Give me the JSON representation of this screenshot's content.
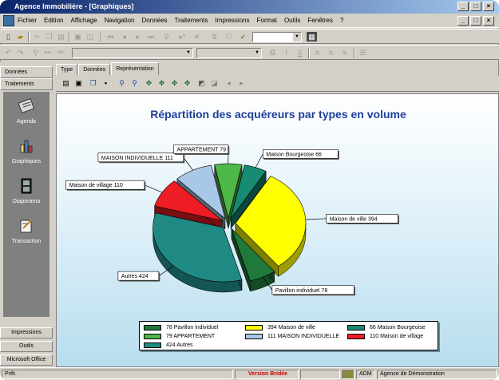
{
  "window": {
    "title": "Agence Immobilière - [Graphiques]",
    "buttons": [
      "_",
      "□",
      "×"
    ]
  },
  "menubar": {
    "items": [
      "Fichier",
      "Edition",
      "Affichage",
      "Navigation",
      "Données",
      "Traitements",
      "Impressions",
      "Format",
      "Outils",
      "Fenêtres",
      "?"
    ],
    "mdi_buttons": [
      "_",
      "□",
      "×"
    ]
  },
  "toolbar1": {
    "icons": [
      "new-icon",
      "open-icon",
      "cut-icon",
      "copy-icon",
      "paste-icon",
      "print-icon",
      "print-preview-icon",
      "first-record-icon",
      "previous-record-icon",
      "next-record-icon",
      "last-record-icon",
      "find-icon",
      "new-record-icon",
      "delete-record-icon",
      "sort-icon",
      "filter-icon",
      "check-icon",
      "color-icon"
    ]
  },
  "toolbar2": {
    "icons": [
      "undo-icon",
      "redo-icon",
      "find-icon",
      "replace-icon",
      "spelling-icon",
      "bold-icon",
      "italic-icon",
      "underline-icon",
      "align-left-icon",
      "align-center-icon",
      "align-right-icon",
      "bullets-icon"
    ],
    "bold_glyph": "G",
    "italic_glyph": "I",
    "underline_glyph": "S"
  },
  "leftpanel": {
    "top_sections": [
      "Données",
      "Traitements"
    ],
    "items": [
      {
        "label": "Agenda",
        "icon": "agenda-icon"
      },
      {
        "label": "Graphiques",
        "icon": "graphics-icon"
      },
      {
        "label": "Diaporama",
        "icon": "slideshow-icon"
      },
      {
        "label": "Transaction",
        "icon": "transaction-icon"
      }
    ],
    "bottom_sections": [
      "Impressions",
      "Outils",
      "Microsoft Office"
    ]
  },
  "tabs": [
    {
      "label": "Type",
      "active": false
    },
    {
      "label": "Données",
      "active": false
    },
    {
      "label": "Représentation",
      "active": true
    }
  ],
  "chartbar": {
    "icons": [
      "print-icon",
      "print-setup-icon",
      "copy-chart-icon",
      "save-icon",
      "zoom-out-icon",
      "zoom-in-icon",
      "move-icon",
      "rotate-left-icon",
      "rotate-right-icon",
      "tilt-icon",
      "chart-3d-icon",
      "chart-style-icon",
      "scroll-left-icon",
      "scroll-right-icon"
    ]
  },
  "chart_data": {
    "type": "pie",
    "title": "Répartition des acquéreurs par types en volume",
    "slices": [
      {
        "label": "Maison de ville 394",
        "name": "Maison de ville",
        "value": 394,
        "color": "#ffff00"
      },
      {
        "label": "Pavillon individuel 78",
        "name": "Pavillon individuel",
        "value": 78,
        "color": "#1f7a3a"
      },
      {
        "label": "Autres 424",
        "name": "Autres",
        "value": 424,
        "color": "#1f8a84"
      },
      {
        "label": "Maison de village 110",
        "name": "Maison de village",
        "value": 110,
        "color": "#ee1c24"
      },
      {
        "label": "MAISON INDIVIDUELLE 111",
        "name": "MAISON INDIVIDUELLE",
        "value": 111,
        "color": "#a9c8e8"
      },
      {
        "label": "APPARTEMENT 79",
        "name": "APPARTEMENT",
        "value": 79,
        "color": "#4db848"
      },
      {
        "label": "Maison Bourgeoise 66",
        "name": "Maison Bourgeoise",
        "value": 66,
        "color": "#178a72"
      }
    ],
    "legend": [
      {
        "text": "78 Pavillon individuel",
        "color": "#1f7a3a"
      },
      {
        "text": "394 Maison de ville",
        "color": "#ffff00"
      },
      {
        "text": "66 Maison Bourgeoise",
        "color": "#178a72"
      },
      {
        "text": "79 APPARTEMENT",
        "color": "#4db848"
      },
      {
        "text": "111 MAISON INDIVIDUELLE",
        "color": "#a9c8e8"
      },
      {
        "text": "110 Maison de village",
        "color": "#ee1c24"
      },
      {
        "text": "424 Autres",
        "color": "#1f8a84"
      }
    ],
    "legend_position": "bottom"
  },
  "statusbar": {
    "ready": "Prêt.",
    "version": "Version Bridée",
    "user": "ADM",
    "agency": "Agence de Démonstration"
  }
}
